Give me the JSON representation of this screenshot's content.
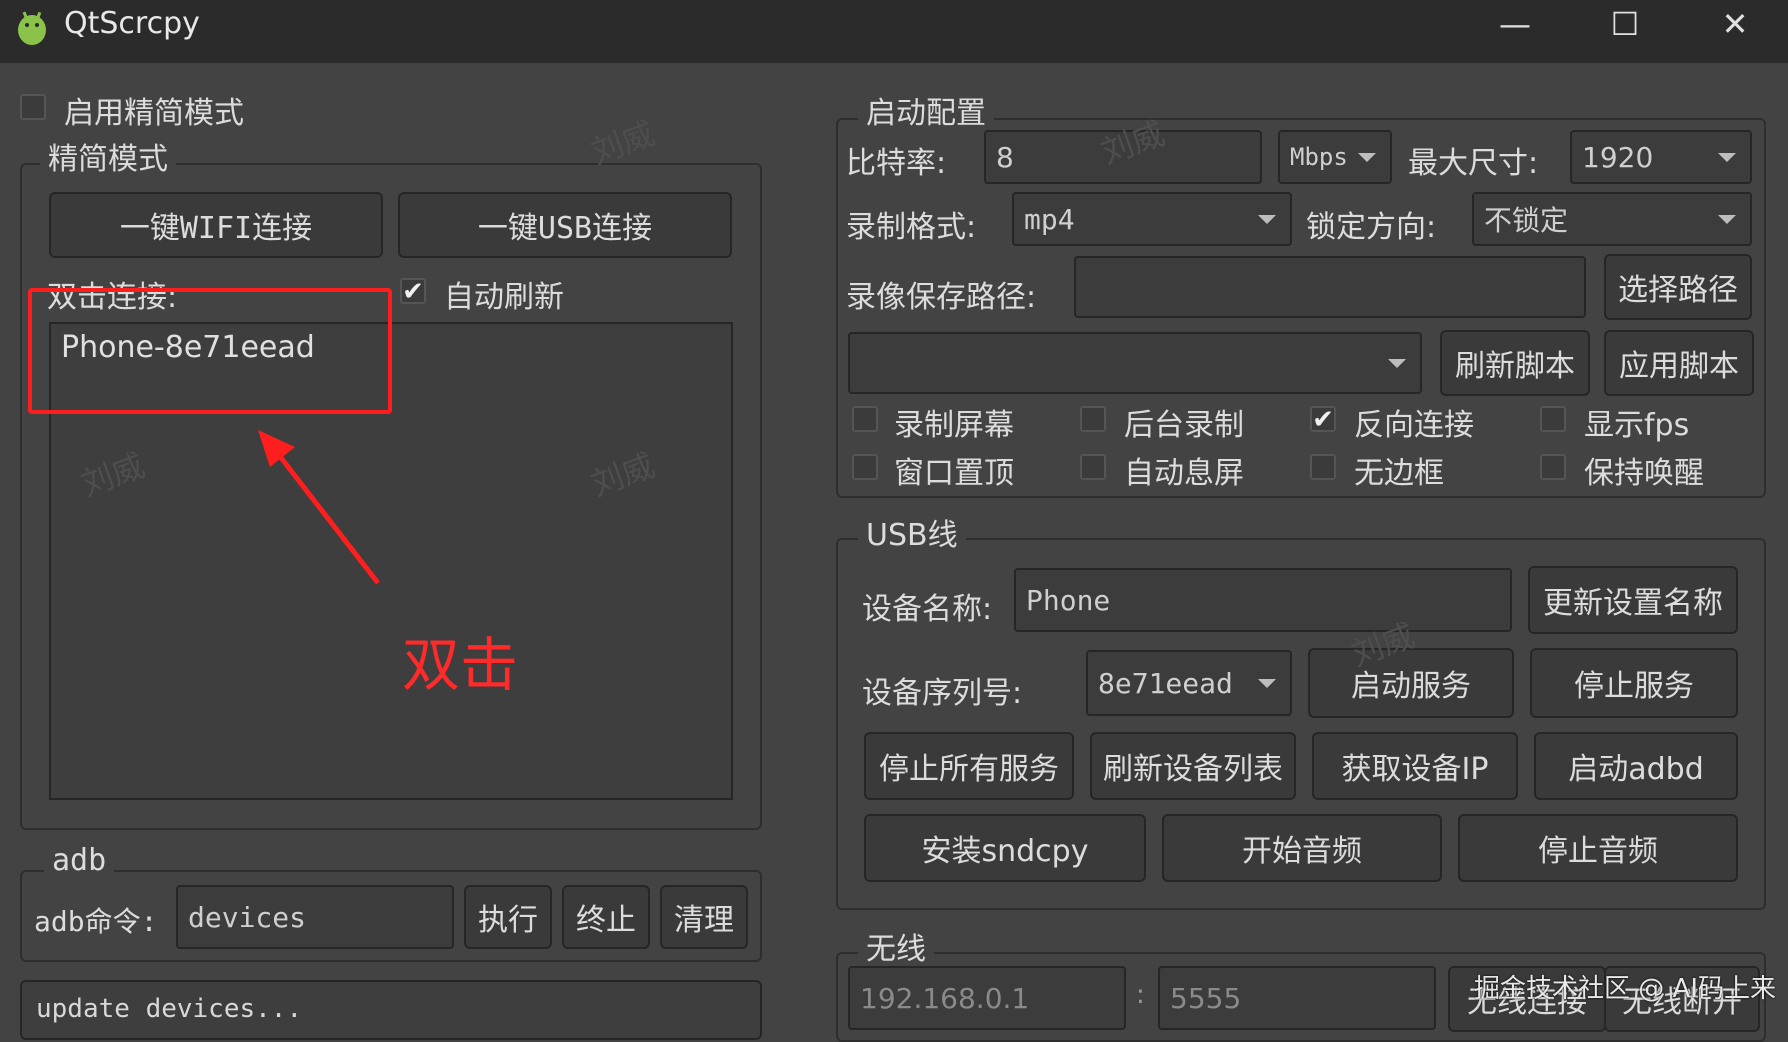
{
  "window": {
    "title": "QtScrcpy",
    "minimize": "—",
    "maximize": "☐",
    "close": "✕"
  },
  "simple_mode": {
    "enable_label": "启用精简模式",
    "group_title": "精简模式",
    "wifi_button": "一键WIFI连接",
    "usb_button": "一键USB连接",
    "double_click_label": "双击连接:",
    "auto_refresh_label": "自动刷新",
    "devices": [
      "Phone-8e71eead"
    ]
  },
  "annotation": {
    "double_click": "双击",
    "highlight_color": "#ff1e1e"
  },
  "adb": {
    "group_title": "adb",
    "cmd_label": "adb命令:",
    "cmd_value": "devices",
    "run_button": "执行",
    "stop_button": "终止",
    "clear_button": "清理",
    "log_text": "update devices..."
  },
  "launch": {
    "group_title": "启动配置",
    "bitrate_label": "比特率:",
    "bitrate_value": "8",
    "bitrate_unit": "Mbps",
    "max_size_label": "最大尺寸:",
    "max_size_value": "1920",
    "record_format_label": "录制格式:",
    "record_format_value": "mp4",
    "lock_orientation_label": "锁定方向:",
    "lock_orientation_value": "不锁定",
    "record_path_label": "录像保存路径:",
    "record_path_value": "",
    "select_path_button": "选择路径",
    "script_value": "",
    "refresh_script_button": "刷新脚本",
    "apply_script_button": "应用脚本",
    "checkboxes": [
      {
        "label": "录制屏幕",
        "checked": false
      },
      {
        "label": "后台录制",
        "checked": false
      },
      {
        "label": "反向连接",
        "checked": true
      },
      {
        "label": "显示fps",
        "checked": false
      },
      {
        "label": "窗口置顶",
        "checked": false
      },
      {
        "label": "自动息屏",
        "checked": false
      },
      {
        "label": "无边框",
        "checked": false
      },
      {
        "label": "保持唤醒",
        "checked": false
      }
    ]
  },
  "usb": {
    "group_title": "USB线",
    "device_name_label": "设备名称:",
    "device_name_value": "Phone",
    "update_name_button": "更新设置名称",
    "serial_label": "设备序列号:",
    "serial_value": "8e71eead",
    "start_service_button": "启动服务",
    "stop_service_button": "停止服务",
    "stop_all_button": "停止所有服务",
    "refresh_list_button": "刷新设备列表",
    "get_ip_button": "获取设备IP",
    "start_adbd_button": "启动adbd",
    "install_sndcpy_button": "安装sndcpy",
    "start_audio_button": "开始音频",
    "stop_audio_button": "停止音频"
  },
  "wireless": {
    "group_title": "无线",
    "ip_value": "192.168.0.1",
    "separator": ":",
    "port_value": "5555",
    "connect_button": "无线连接",
    "disconnect_button": "无线断开"
  },
  "watermark": {
    "source": "掘金技术社区 @ AI码上来",
    "ghost": "刘威"
  }
}
